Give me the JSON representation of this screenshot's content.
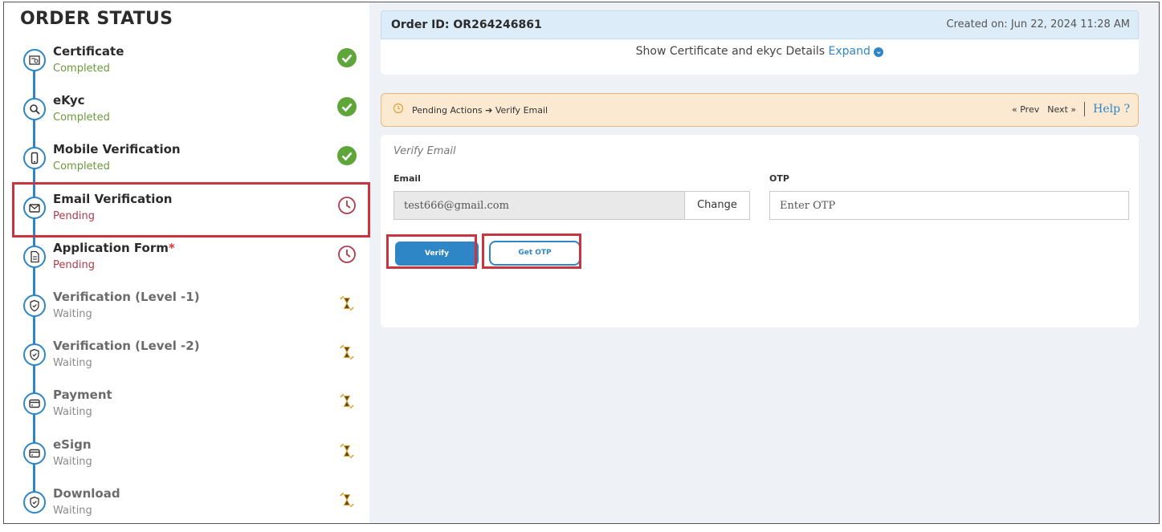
{
  "sidebar": {
    "title": "ORDER STATUS",
    "steps": [
      {
        "name": "Certificate",
        "status": "Completed",
        "state": "completed",
        "icon": "certificate-icon"
      },
      {
        "name": "eKyc",
        "status": "Completed",
        "state": "completed",
        "icon": "search-id-icon"
      },
      {
        "name": "Mobile Verification",
        "status": "Completed",
        "state": "completed",
        "icon": "mobile-icon"
      },
      {
        "name": "Email Verification",
        "status": "Pending",
        "state": "pending",
        "icon": "mail-icon"
      },
      {
        "name": "Application Form",
        "required_mark": "*",
        "status": "Pending",
        "state": "pending",
        "icon": "document-icon"
      },
      {
        "name": "Verification (Level -1)",
        "status": "Waiting",
        "state": "waiting",
        "icon": "shield-icon"
      },
      {
        "name": "Verification (Level -2)",
        "status": "Waiting",
        "state": "waiting",
        "icon": "shield-icon"
      },
      {
        "name": "Payment",
        "status": "Waiting",
        "state": "waiting",
        "icon": "card-icon"
      },
      {
        "name": "eSign",
        "status": "Waiting",
        "state": "waiting",
        "icon": "card-icon"
      },
      {
        "name": "Download",
        "status": "Waiting",
        "state": "waiting",
        "icon": "shield-icon"
      }
    ]
  },
  "header": {
    "order_id": "Order ID: OR264246861",
    "created_on": "Created on: Jun 22, 2024 11:28 AM"
  },
  "cert_bar": {
    "text": "Show Certificate and ekyc Details",
    "expand": "Expand"
  },
  "pending_bar": {
    "crumb": "Pending Actions ➔ Verify Email",
    "prev": "« Prev",
    "next": "Next »",
    "help": "Help ?"
  },
  "form": {
    "title": "Verify Email",
    "email_label": "Email",
    "email_value": "test666@gmail.com",
    "change_label": "Change",
    "otp_label": "OTP",
    "otp_placeholder": "Enter OTP",
    "verify_label": "Verify",
    "get_otp_label": "Get OTP"
  },
  "colors": {
    "accent": "#2f86c6",
    "completed": "#5ea63a",
    "pending": "#b23a4a",
    "waiting": "#e0a030",
    "highlight": "#c9353f"
  }
}
